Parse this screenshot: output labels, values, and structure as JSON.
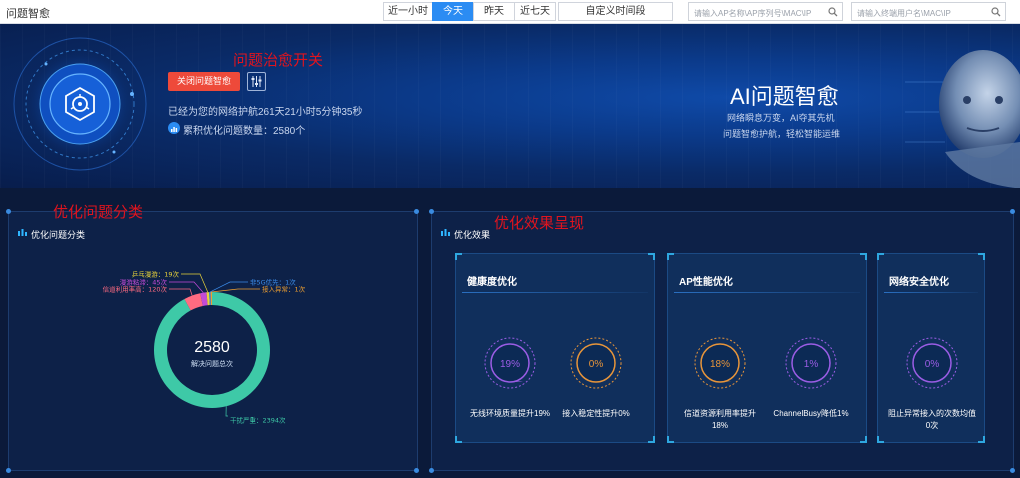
{
  "topbar": {
    "title": "问题智愈",
    "tabs": [
      {
        "label": "近一小时",
        "active": false
      },
      {
        "label": "今天",
        "active": true
      },
      {
        "label": "昨天",
        "active": false
      },
      {
        "label": "近七天",
        "active": false
      }
    ],
    "custom_range": "自定义时间段",
    "search_ap_placeholder": "请输入AP名称\\AP序列号\\MAC\\IP",
    "search_user_placeholder": "请输入终端用户名\\MAC\\IP"
  },
  "annotations": {
    "switch": "问题治愈开关",
    "category": "优化问题分类",
    "effect": "优化效果呈现"
  },
  "banner": {
    "close_button": "关闭问题智愈",
    "uptime": "已经为您的网络护航261天21小时5分钟35秒",
    "cumulative": "累积优化问题数量：2580个",
    "ai_title": "AI问题智愈",
    "ai_sub1": "网络瞬息万变，AI夺其先机",
    "ai_sub2": "问题智愈护航，轻松智能运维"
  },
  "left_panel": {
    "title": "优化问题分类"
  },
  "right_panel": {
    "title": "优化效果"
  },
  "chart_data": {
    "type": "pie",
    "donut": true,
    "total_value": "2580",
    "total_label": "解决问题总次",
    "slices": [
      {
        "label": "干扰严重：2394次",
        "value": 2394,
        "color": "#3ec9a7"
      },
      {
        "label": "信道利用率高：120次",
        "value": 120,
        "color": "#ff6b81"
      },
      {
        "label": "漫游粘滞：45次",
        "value": 45,
        "color": "#c34bd6"
      },
      {
        "label": "乒乓漫游：19次",
        "value": 19,
        "color": "#e8d23a"
      },
      {
        "label": "非5G优先：1次",
        "value": 1,
        "color": "#3b8be8"
      },
      {
        "label": "接入异常：1次",
        "value": 1,
        "color": "#f0a030"
      }
    ]
  },
  "cards": [
    {
      "title": "健康度优化",
      "metrics": [
        {
          "value": "19%",
          "label": "无线环境质量提升19%",
          "color": "#9b5de5"
        },
        {
          "value": "0%",
          "label": "接入稳定性提升0%",
          "color": "#e8953a"
        }
      ]
    },
    {
      "title": "AP性能优化",
      "metrics": [
        {
          "value": "18%",
          "label": "信道资源利用率提升18%",
          "color": "#e8953a"
        },
        {
          "value": "1%",
          "label": "ChannelBusy降低1%",
          "color": "#9b5de5"
        }
      ]
    },
    {
      "title": "网络安全优化",
      "metrics": [
        {
          "value": "0%",
          "label": "阻止异常接入的次数均值0次",
          "color": "#9b5de5"
        }
      ]
    }
  ]
}
